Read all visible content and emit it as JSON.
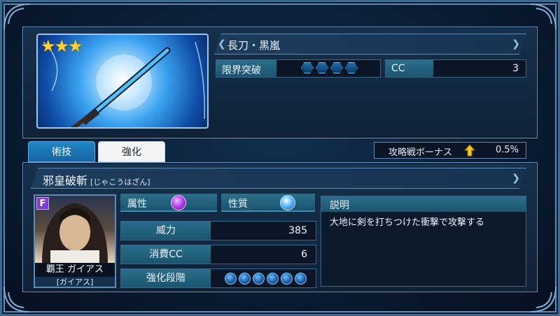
{
  "weapon": {
    "stars": "★★★",
    "name": "長刀・黒嵐",
    "limit_break_label": "限界突破",
    "limit_break_level": 4,
    "cc_label": "CC",
    "cc_value": "3"
  },
  "tabs": {
    "skill": "術技",
    "enhance": "強化"
  },
  "bonus": {
    "label": "攻略戦ボーナス",
    "value": "0.5%"
  },
  "skill": {
    "name": "邪皇破斬",
    "reading": "[じゃこうはざん]",
    "attribute_label": "属性",
    "nature_label": "性質",
    "power_label": "威力",
    "power_value": "385",
    "cost_label": "消費CC",
    "cost_value": "6",
    "stage_label": "強化段階",
    "stage_count": 6,
    "desc_label": "説明",
    "desc_text": "大地に剣を打ちつけた衝撃で攻撃する"
  },
  "character": {
    "rank": "F",
    "name": "覇王 ガイアス",
    "sub": "[ガイアス]"
  },
  "colors": {
    "accent": "#1f86c6",
    "label_bg": "#2a6f8a",
    "star": "#ffd23a"
  }
}
